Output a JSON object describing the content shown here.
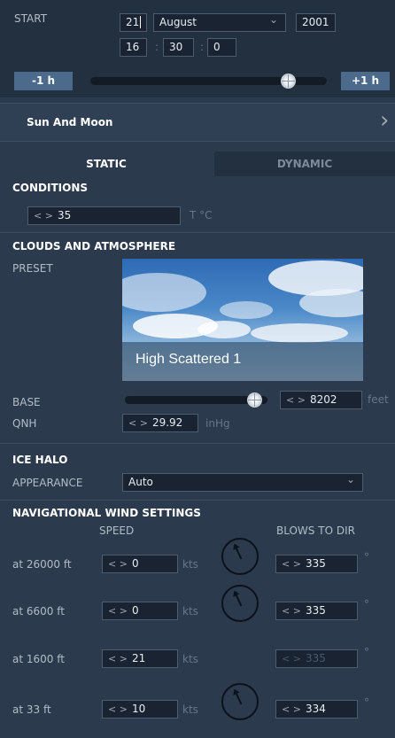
{
  "time": {
    "start_label": "START",
    "day": "21",
    "month": "August",
    "year": "2001",
    "hour": "16",
    "minute": "30",
    "second": "0",
    "colon": ":",
    "minus_label": "-1 h",
    "plus_label": "+1 h",
    "slider_fraction": 0.84
  },
  "sun_moon": {
    "label": "Sun And Moon"
  },
  "tabs": [
    {
      "label": "STATIC",
      "active": true
    },
    {
      "label": "DYNAMIC",
      "active": false
    }
  ],
  "conditions": {
    "title": "CONDITIONS",
    "temperature": "35",
    "temperature_unit": "T °C"
  },
  "clouds": {
    "title": "CLOUDS AND ATMOSPHERE",
    "preset_label": "PRESET",
    "preset_name": "High Scattered 1",
    "base_label": "BASE",
    "base_value": "8202",
    "base_unit": "feet",
    "base_slider_fraction": 0.91,
    "qnh_label": "QNH",
    "qnh_value": "29.92",
    "qnh_unit": "inHg"
  },
  "ice_halo": {
    "title": "ICE HALO",
    "appearance_label": "APPEARANCE",
    "appearance_value": "Auto"
  },
  "wind": {
    "title": "NAVIGATIONAL WIND SETTINGS",
    "speed_header": "SPEED",
    "dir_header": "BLOWS TO DIR",
    "speed_unit": "kts",
    "deg_unit": "°",
    "rows": [
      {
        "label": "at 26000 ft",
        "speed": "0",
        "dir": "335",
        "dial": true
      },
      {
        "label": "at 6600 ft",
        "speed": "0",
        "dir": "335",
        "dial": true
      },
      {
        "label": "at 1600 ft",
        "speed": "21",
        "dir": "335",
        "dial": false
      },
      {
        "label": "at 33 ft",
        "speed": "10",
        "dir": "334",
        "dial": true
      }
    ]
  },
  "icons": {
    "spin_arrows": "< >",
    "dropdown": "⌄",
    "chevron_right": "›"
  },
  "colors": {
    "background": "#2b3a4c",
    "header_band": "#23303f",
    "field": "#192331",
    "button": "#4b6a8c"
  }
}
